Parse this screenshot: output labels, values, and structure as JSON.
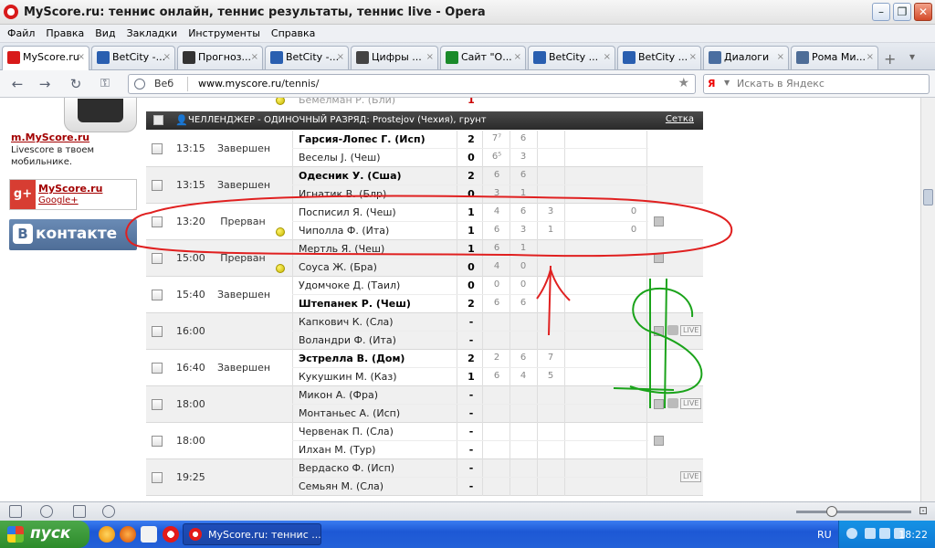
{
  "window": {
    "title": "MyScore.ru: теннис онлайн, теннис результаты, теннис live - Opera"
  },
  "menu": [
    "Файл",
    "Правка",
    "Вид",
    "Закладки",
    "Инструменты",
    "Справка"
  ],
  "tabs": [
    {
      "label": "MyScore.ru",
      "icon": "myscore-icon",
      "color": "#d81a1a",
      "active": true
    },
    {
      "label": "BetCity -...",
      "icon": "betcity-icon",
      "color": "#2a5fb0"
    },
    {
      "label": "Прогноз...",
      "icon": "ball-icon",
      "color": "#333333"
    },
    {
      "label": "BetCity -...",
      "icon": "betcity-icon",
      "color": "#2a5fb0"
    },
    {
      "label": "Цифры ...",
      "icon": "digits-icon",
      "color": "#444444"
    },
    {
      "label": "Сайт \"О...",
      "icon": "site-icon",
      "color": "#1a8a2a"
    },
    {
      "label": "BetCity ...",
      "icon": "betcity-icon",
      "color": "#2a5fb0"
    },
    {
      "label": "BetCity ...",
      "icon": "betcity-icon",
      "color": "#2a5fb0"
    },
    {
      "label": "Диалоги",
      "icon": "dialogs-icon",
      "color": "#4a6ea0"
    },
    {
      "label": "Рома Ми...",
      "icon": "vk-icon",
      "color": "#4e6d97"
    }
  ],
  "address": {
    "label": "Веб",
    "url_host": "www.myscore.ru",
    "url_path": "/tennis/",
    "search_placeholder": "Искать в Яндекс",
    "search_engine_badge": "Я"
  },
  "sidebar": {
    "mobile_link": "m.MyScore.ru",
    "mobile_desc": "Livescore в твоем мобильнике.",
    "gplus_title": "MyScore.ru",
    "gplus_sub": "Google+",
    "gplus_badge": "g+",
    "vk_badge": "B",
    "vk_label": "контакте"
  },
  "partial_top": {
    "player": "Бёмелман Р. (Бли)",
    "score": "1"
  },
  "tournament": {
    "name": "ЧЕЛЛЕНДЖЕР - ОДИНОЧНЫЙ РАЗРЯД: Prostejov (Чехия), грунт",
    "draw_link": "Сетка"
  },
  "matches": [
    {
      "time": "13:15",
      "status": "Завершен",
      "p1": {
        "name": "Гарсия-Лопес Г. (Исп)",
        "score": "2",
        "sets": [
          "7⁷",
          "6",
          ""
        ],
        "win": true
      },
      "p2": {
        "name": "Веселы J. (Чеш)",
        "score": "0",
        "sets": [
          "6⁵",
          "3",
          ""
        ],
        "win": false
      },
      "ball": false,
      "icons": ""
    },
    {
      "time": "13:15",
      "status": "Завершен",
      "p1": {
        "name": "Одесник У. (Сша)",
        "score": "2",
        "sets": [
          "6",
          "6",
          ""
        ],
        "win": true
      },
      "p2": {
        "name": "Игнатик В. (Блр)",
        "score": "0",
        "sets": [
          "3",
          "1",
          ""
        ],
        "win": false
      },
      "ball": false,
      "icons": ""
    },
    {
      "time": "13:20",
      "status": "Прерван",
      "p1": {
        "name": "Посписил Я. (Чеш)",
        "score": "1",
        "sets": [
          "4",
          "6",
          "3"
        ],
        "extra": "0",
        "win": false
      },
      "p2": {
        "name": "Чиполла Ф. (Ита)",
        "score": "1",
        "sets": [
          "6",
          "3",
          "1"
        ],
        "extra": "0",
        "win": false
      },
      "ball": true,
      "icons": "tv"
    },
    {
      "time": "15:00",
      "status": "Прерван",
      "p1": {
        "name": "Мертль Я. (Чеш)",
        "score": "1",
        "sets": [
          "6",
          "1",
          ""
        ],
        "win": false
      },
      "p2": {
        "name": "Соуса Ж. (Бра)",
        "score": "0",
        "sets": [
          "4",
          "0",
          ""
        ],
        "win": false
      },
      "ball": true,
      "icons": "tv"
    },
    {
      "time": "15:40",
      "status": "Завершен",
      "p1": {
        "name": "Удомчоке Д. (Таил)",
        "score": "0",
        "sets": [
          "0",
          "0",
          ""
        ],
        "win": false
      },
      "p2": {
        "name": "Штепанек Р. (Чеш)",
        "score": "2",
        "sets": [
          "6",
          "6",
          ""
        ],
        "win": true
      },
      "ball": false,
      "icons": ""
    },
    {
      "time": "16:00",
      "status": "",
      "p1": {
        "name": "Капкович К. (Сла)",
        "score": "-",
        "sets": [
          "",
          "",
          ""
        ],
        "win": false
      },
      "p2": {
        "name": "Воландри Ф. (Ита)",
        "score": "-",
        "sets": [
          "",
          "",
          ""
        ],
        "win": false
      },
      "ball": false,
      "icons": "tv-live"
    },
    {
      "time": "16:40",
      "status": "Завершен",
      "p1": {
        "name": "Эстрелла В. (Дом)",
        "score": "2",
        "sets": [
          "2",
          "6",
          "7"
        ],
        "win": true
      },
      "p2": {
        "name": "Кукушкин М. (Каз)",
        "score": "1",
        "sets": [
          "6",
          "4",
          "5"
        ],
        "win": false
      },
      "ball": false,
      "icons": ""
    },
    {
      "time": "18:00",
      "status": "",
      "p1": {
        "name": "Микон А. (Фра)",
        "score": "-",
        "sets": [
          "",
          "",
          ""
        ],
        "win": false
      },
      "p2": {
        "name": "Монтаньес А. (Исп)",
        "score": "-",
        "sets": [
          "",
          "",
          ""
        ],
        "win": false
      },
      "ball": false,
      "icons": "tv-live"
    },
    {
      "time": "18:00",
      "status": "",
      "p1": {
        "name": "Червенак П. (Сла)",
        "score": "-",
        "sets": [
          "",
          "",
          ""
        ],
        "win": false
      },
      "p2": {
        "name": "Илхан М. (Тур)",
        "score": "-",
        "sets": [
          "",
          "",
          ""
        ],
        "win": false
      },
      "ball": false,
      "icons": "tv"
    },
    {
      "time": "19:25",
      "status": "",
      "p1": {
        "name": "Вердаско Ф. (Исп)",
        "score": "-",
        "sets": [
          "",
          "",
          ""
        ],
        "win": false
      },
      "p2": {
        "name": "Семьян М. (Сла)",
        "score": "-",
        "sets": [
          "",
          "",
          ""
        ],
        "win": false
      },
      "ball": false,
      "icons": "live"
    }
  ],
  "live_badge": "LIVE",
  "taskbar": {
    "start": "пуск",
    "task_title": "MyScore.ru: теннис ...",
    "lang": "RU",
    "clock": "18:22"
  },
  "colors": {
    "highlight_red": "#e02020",
    "annotation_green": "#1aa31a",
    "tournament_header": "#333333"
  }
}
